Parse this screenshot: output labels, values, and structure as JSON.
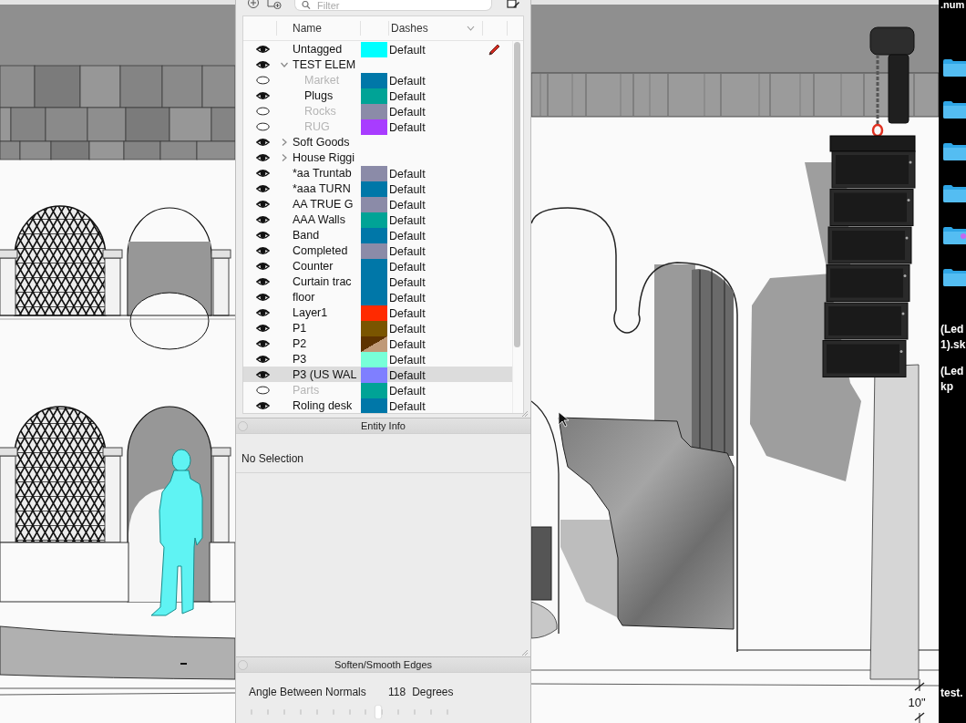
{
  "tags_panel": {
    "toolbar": {
      "filter": {
        "placeholder": "Filter"
      }
    },
    "columns": [
      {
        "label": "Name",
        "kind": "text"
      },
      {
        "label": "Dashes",
        "kind": "dropdown"
      }
    ],
    "rows": [
      {
        "kind": "tag",
        "name": "Untagged",
        "visible": true,
        "selected": false,
        "current": true,
        "color": "#00ffff",
        "dashes": "Default"
      },
      {
        "kind": "folder",
        "name": "TEST ELEM",
        "visible": true,
        "selected": false,
        "current": false,
        "expanded": true,
        "children": [
          {
            "kind": "tag",
            "name": "Market",
            "visible": false,
            "selected": false,
            "current": false,
            "color": "#0077a8",
            "dashes": "Default"
          },
          {
            "kind": "tag",
            "name": "Plugs",
            "visible": true,
            "selected": false,
            "current": false,
            "color": "#00a396",
            "dashes": "Default"
          },
          {
            "kind": "tag",
            "name": "Rocks",
            "visible": false,
            "selected": false,
            "current": false,
            "color": "#8b8ba8",
            "dashes": "Default"
          },
          {
            "kind": "tag",
            "name": "RUG",
            "visible": false,
            "selected": false,
            "current": false,
            "color": "#a83cff",
            "dashes": "Default"
          }
        ]
      },
      {
        "kind": "folder",
        "name": "Soft Goods",
        "visible": true,
        "selected": false,
        "current": false,
        "expanded": false
      },
      {
        "kind": "folder",
        "name": "House Riggi",
        "visible": true,
        "selected": false,
        "current": false,
        "expanded": false
      },
      {
        "kind": "tag",
        "name": "*aa Truntab",
        "visible": true,
        "selected": false,
        "current": false,
        "color": "#8b8ba8",
        "dashes": "Default"
      },
      {
        "kind": "tag",
        "name": "*aaa TURN",
        "visible": true,
        "selected": false,
        "current": false,
        "color": "#0077a8",
        "dashes": "Default"
      },
      {
        "kind": "tag",
        "name": "AA TRUE G",
        "visible": true,
        "selected": false,
        "current": false,
        "color": "#8b8ba8",
        "dashes": "Default"
      },
      {
        "kind": "tag",
        "name": "AAA Walls",
        "visible": true,
        "selected": false,
        "current": false,
        "color": "#00a396",
        "dashes": "Default"
      },
      {
        "kind": "tag",
        "name": "Band",
        "visible": true,
        "selected": false,
        "current": false,
        "color": "#0077a8",
        "dashes": "Default"
      },
      {
        "kind": "tag",
        "name": "Completed",
        "visible": true,
        "selected": false,
        "current": false,
        "color": "#8b8ba8",
        "dashes": "Default"
      },
      {
        "kind": "tag",
        "name": "Counter",
        "visible": true,
        "selected": false,
        "current": false,
        "color": "#0077a8",
        "dashes": "Default"
      },
      {
        "kind": "tag",
        "name": "Curtain trac",
        "visible": true,
        "selected": false,
        "current": false,
        "color": "#0077a8",
        "dashes": "Default"
      },
      {
        "kind": "tag",
        "name": "floor",
        "visible": true,
        "selected": false,
        "current": false,
        "color": "#0077a8",
        "dashes": "Default"
      },
      {
        "kind": "tag",
        "name": "Layer1",
        "visible": true,
        "selected": false,
        "current": false,
        "color": "#ff2a00",
        "dashes": "Default"
      },
      {
        "kind": "tag",
        "name": "P1",
        "visible": true,
        "selected": false,
        "current": false,
        "color": "#7a5500",
        "dashes": "Default"
      },
      {
        "kind": "tag",
        "name": "P2",
        "visible": true,
        "selected": false,
        "current": false,
        "color": "#5e3300",
        "texture": {
          "color": "#c09a78"
        },
        "dashes": "Default"
      },
      {
        "kind": "tag",
        "name": "P3",
        "visible": true,
        "selected": false,
        "current": false,
        "color": "#77ffd8",
        "dashes": "Default"
      },
      {
        "kind": "tag",
        "name": "P3 (US WAL",
        "visible": true,
        "selected": true,
        "current": false,
        "color": "#7f7fff",
        "dashes": "Default"
      },
      {
        "kind": "tag",
        "name": "Parts",
        "visible": false,
        "selected": false,
        "current": false,
        "color": "#00a396",
        "dashes": "Default"
      },
      {
        "kind": "tag",
        "name": "Roling desk",
        "visible": true,
        "selected": false,
        "current": false,
        "color": "#0077a8",
        "dashes": "Default"
      }
    ]
  },
  "entity_info": {
    "title": "Entity Info",
    "selection": "No Selection"
  },
  "soften_edges": {
    "title": "Soften/Smooth Edges",
    "angle_label": "Angle Between Normals",
    "angle_value": "118",
    "angle_unit": "Degrees",
    "level": 0.65
  },
  "viewport": {
    "dimension": "10\""
  },
  "desktop": {
    "header_label": ".num",
    "folders": [
      {
        "kind": "folder"
      },
      {
        "kind": "folder"
      },
      {
        "kind": "folder"
      },
      {
        "kind": "folder"
      },
      {
        "kind": "folder",
        "color": "#c468f0"
      },
      {
        "kind": "folder"
      }
    ],
    "file_labels": [
      {
        "lines": [
          "(Led",
          "1).sk"
        ]
      },
      {
        "lines": [
          "(Led",
          "kp"
        ]
      }
    ],
    "footer_label": "test."
  }
}
